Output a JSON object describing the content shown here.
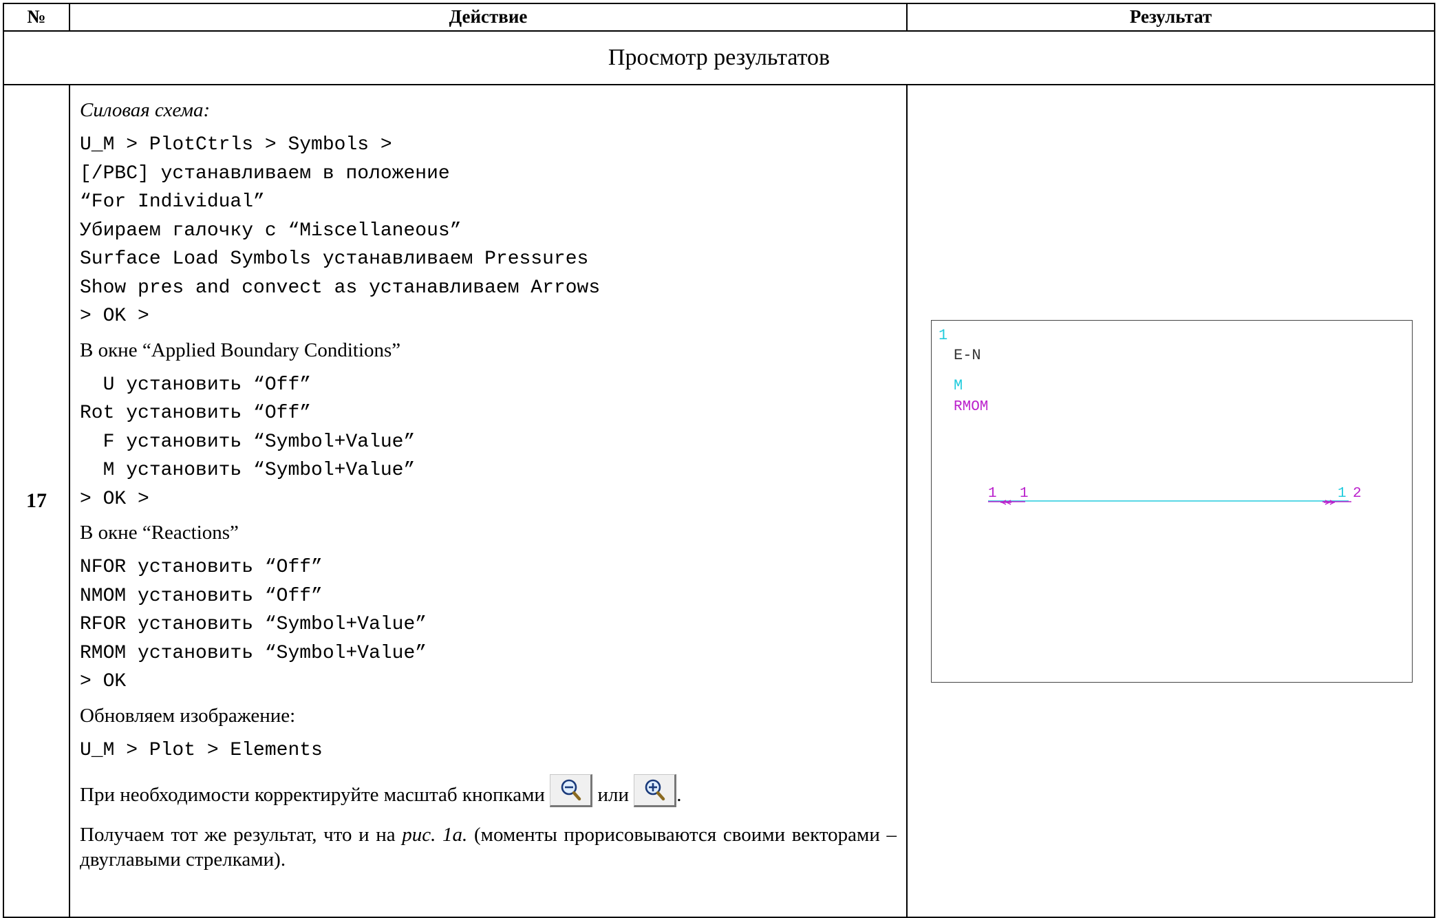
{
  "header": {
    "num": "№",
    "action": "Действие",
    "result": "Результат"
  },
  "section_title": "Просмотр результатов",
  "row": {
    "number": "17",
    "power_scheme_label": "Силовая схема:",
    "code_block_1": [
      "U_M > PlotCtrls > Symbols >",
      "[/PBC] устанавливаем в положение",
      "“For Individual”",
      "Убираем галочку с “Miscellaneous”",
      "Surface Load Symbols устанавливаем Pressures",
      "Show pres and convect as устанавливаем Arrows",
      "> OK >"
    ],
    "applied_bc_label": "В окне “Applied Boundary Conditions”",
    "code_block_2": [
      "  U установить “Off”",
      "Rot установить “Off”",
      "  F установить “Symbol+Value”",
      "  M установить “Symbol+Value”",
      "> OK >"
    ],
    "reactions_label": "В окне “Reactions”",
    "code_block_3": [
      "NFOR установить “Off”",
      "NMOM установить “Off”",
      "RFOR установить “Symbol+Value”",
      "RMOM установить “Symbol+Value”",
      "> OK"
    ],
    "refresh_label": "Обновляем изображение:",
    "code_block_4": "U_M > Plot > Elements",
    "zoom_text_before": "При необходимости корректируйте масштаб кнопками",
    "zoom_text_middle": "или",
    "zoom_text_after": ".",
    "conclusion_before": "Получаем тот же результат, что и на ",
    "conclusion_italic": "рис. 1а.",
    "conclusion_after": " (моменты прорисовываются своими векторами – двуглавыми стрелками)."
  },
  "plot": {
    "window_number": "1",
    "plot_type": "E-N",
    "legend_m": "M",
    "legend_rmom": "RMOM",
    "node_left_label": "1",
    "element_left_label": "1",
    "element_right_label": "1",
    "node_right_label": "2",
    "colors": {
      "cyan": "#22ccdd",
      "magenta": "#bb22cc",
      "dark": "#333333"
    }
  },
  "icons": {
    "zoom_out": "zoom-out-icon",
    "zoom_in": "zoom-in-icon"
  }
}
